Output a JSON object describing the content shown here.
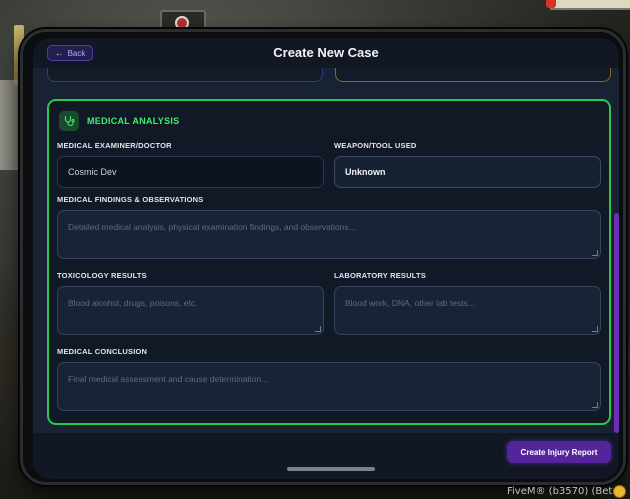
{
  "header": {
    "back_label": "Back",
    "title": "Create New Case"
  },
  "section": {
    "title": "MEDICAL ANALYSIS",
    "icon": "stethoscope-icon",
    "accent_color": "#28c94e"
  },
  "fields": {
    "examiner": {
      "label": "MEDICAL EXAMINER/DOCTOR",
      "value": "Cosmic Dev"
    },
    "weapon": {
      "label": "WEAPON/TOOL USED",
      "value": "Unknown"
    },
    "findings": {
      "label": "MEDICAL FINDINGS & OBSERVATIONS",
      "placeholder": "Detailed medical analysis, physical examination findings, and observations..."
    },
    "toxicology": {
      "label": "TOXICOLOGY RESULTS",
      "placeholder": "Blood alcohol, drugs, poisons, etc."
    },
    "laboratory": {
      "label": "LABORATORY RESULTS",
      "placeholder": "Blood work, DNA, other lab tests..."
    },
    "conclusion": {
      "label": "MEDICAL CONCLUSION",
      "placeholder": "Final medical assessment and cause determination..."
    }
  },
  "footer": {
    "submit_label": "Create Injury Report",
    "submit_color": "#55249c"
  },
  "watermark": {
    "text": "FiveM® (b3570) (Beta)"
  }
}
